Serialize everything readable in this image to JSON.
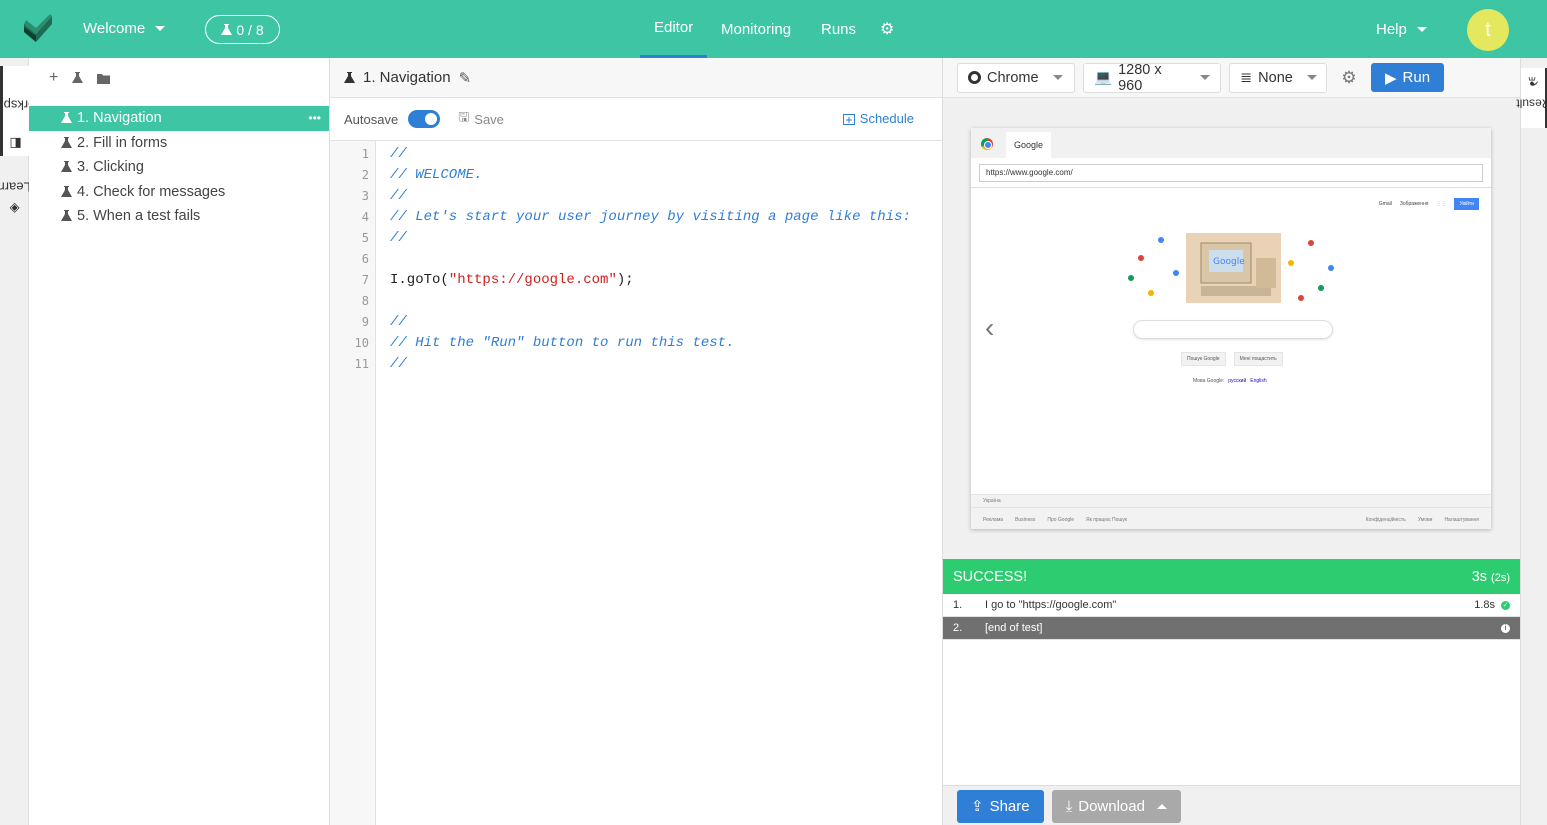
{
  "topbar": {
    "project": "Welcome",
    "counter": "0 / 8",
    "nav": [
      "Editor",
      "Monitoring",
      "Runs"
    ],
    "active_nav": "Editor",
    "help": "Help",
    "avatar": "t"
  },
  "left_tabs": [
    "Workspace",
    "Learn"
  ],
  "tree": {
    "items": [
      {
        "label": "1. Navigation"
      },
      {
        "label": "2. Fill in forms"
      },
      {
        "label": "3. Clicking"
      },
      {
        "label": "4. Check for messages"
      },
      {
        "label": "5. When a test fails"
      }
    ],
    "selected_more": "•••"
  },
  "editor": {
    "title": "1. Navigation",
    "autosave_label": "Autosave",
    "autosave_on": true,
    "save_label": "Save",
    "schedule_label": "Schedule",
    "line_numbers": [
      "1",
      "2",
      "3",
      "4",
      "5",
      "6",
      "7",
      "8",
      "9",
      "10",
      "11"
    ],
    "code": {
      "l1": "//",
      "l2": "// WELCOME.",
      "l3": "//",
      "l4": "// Let's start your user journey by visiting a page like this:",
      "l5": "//",
      "l7_pre": "I.goTo(",
      "l7_str": "\"https://google.com\"",
      "l7_post": ");",
      "l9": "//",
      "l10": "// Hit the \"Run\" button to run this test.",
      "l11": "//"
    }
  },
  "runner": {
    "browser": "Chrome",
    "resolution": "1280 x 960",
    "location": "None",
    "run_label": "Run"
  },
  "screenshot": {
    "tab_title": "Google",
    "url": "https://www.google.com/",
    "top_links": [
      "Gmail",
      "Зображення"
    ],
    "sign_in": "Увійти",
    "buttons": [
      "Пошук Google",
      "Мені пощастить"
    ],
    "lang_prefix": "Мова Google:",
    "langs": [
      "русский",
      "English"
    ],
    "country": "Україна",
    "footer_left": [
      "Реклама",
      "Business",
      "Про Google",
      "Як працює Пошук"
    ],
    "footer_right": [
      "Конфіденційність",
      "Умови",
      "Налаштування"
    ]
  },
  "result": {
    "status": "SUCCESS!",
    "total": "3s",
    "total_sub": "(2s)",
    "steps": [
      {
        "n": "1.",
        "text": "I go to \"https://google.com\"",
        "time": "1.8s"
      },
      {
        "n": "2.",
        "text": "[end of test]",
        "time": ""
      }
    ]
  },
  "actions": {
    "share": "Share",
    "download": "Download"
  },
  "right_tab": "Result",
  "colors": {
    "brand": "#3ec6a4",
    "primary": "#2f7fd6",
    "success": "#2ecc71",
    "code_comment": "#2f7fd6",
    "code_string": "#d12020"
  }
}
